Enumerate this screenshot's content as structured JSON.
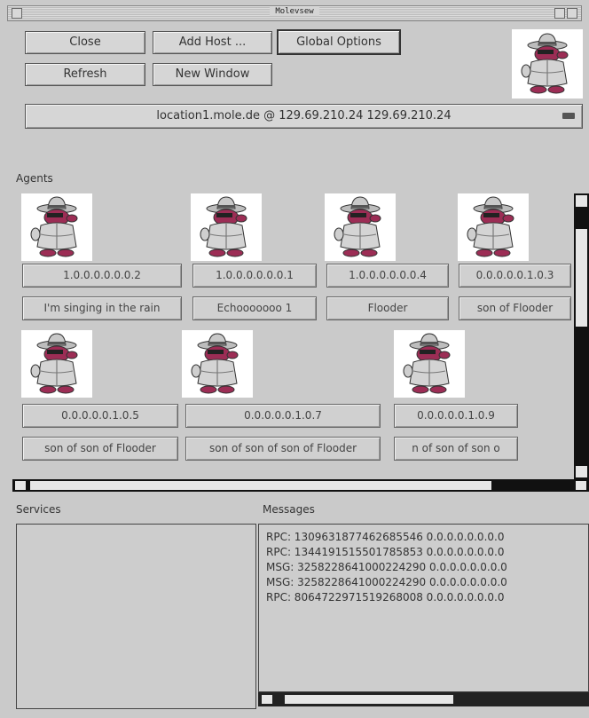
{
  "window": {
    "title": "Molevsew"
  },
  "toolbar": {
    "close": "Close",
    "add_host": "Add Host ...",
    "global_options": "Global Options",
    "refresh": "Refresh",
    "new_window": "New Window"
  },
  "location": {
    "selected": "location1.mole.de @ 129.69.210.24 129.69.210.24"
  },
  "agents": {
    "heading": "Agents",
    "items": [
      {
        "id": "1.0.0.0.0.0.0.2",
        "name": "I'm singing in the rain"
      },
      {
        "id": "1.0.0.0.0.0.0.1",
        "name": "Echooooooo 1"
      },
      {
        "id": "1.0.0.0.0.0.0.4",
        "name": "Flooder"
      },
      {
        "id": "0.0.0.0.0.1.0.3",
        "name": "son of Flooder"
      },
      {
        "id": "0.0.0.0.0.1.0.5",
        "name": "son of son of Flooder"
      },
      {
        "id": "0.0.0.0.0.1.0.7",
        "name": "son of son of son of Flooder"
      },
      {
        "id": "0.0.0.0.0.1.0.9",
        "name": "n of son of son o"
      }
    ]
  },
  "services": {
    "heading": "Services"
  },
  "messages": {
    "heading": "Messages",
    "lines": [
      "RPC: 1309631877462685546 0.0.0.0.0.0.0.0",
      "RPC: 1344191515501785853 0.0.0.0.0.0.0.0",
      "MSG: 3258228641000224290 0.0.0.0.0.0.0.0",
      "MSG: 3258228641000224290 0.0.0.0.0.0.0.0",
      "RPC: 8064722971519268008 0.0.0.0.0.0.0.0"
    ]
  }
}
